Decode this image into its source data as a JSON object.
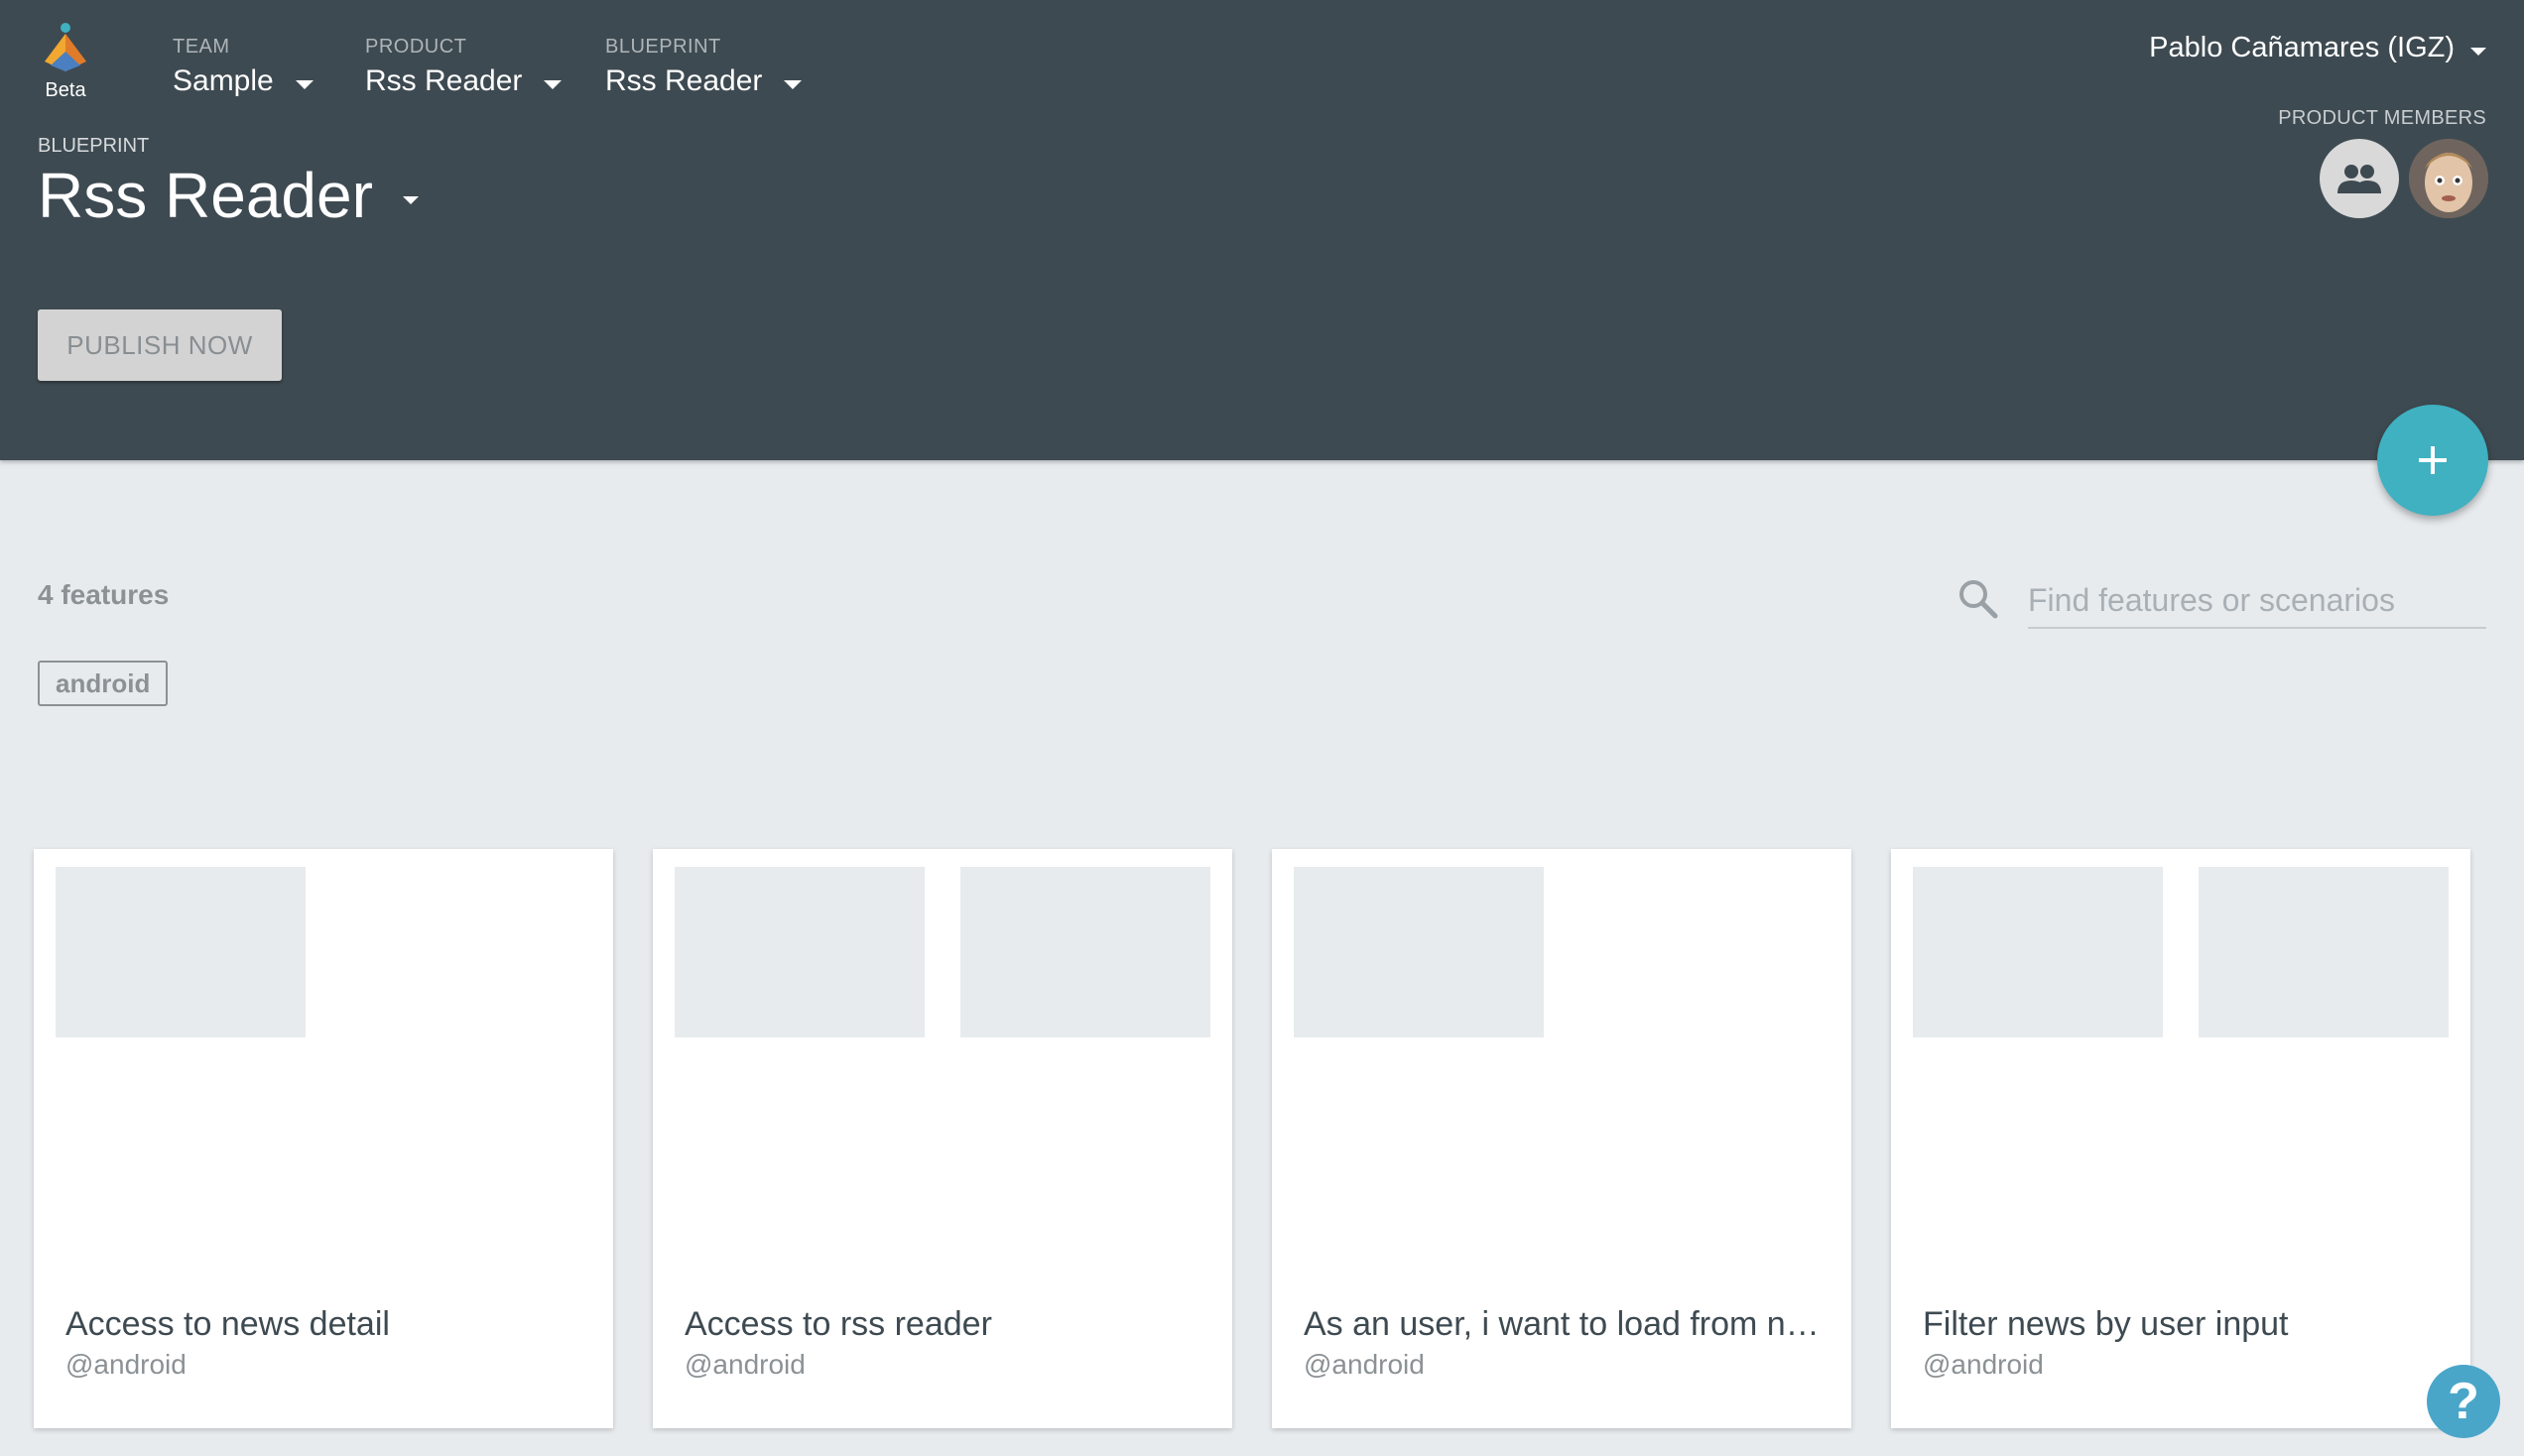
{
  "logo": {
    "label": "Beta"
  },
  "nav": [
    {
      "label": "TEAM",
      "value": "Sample"
    },
    {
      "label": "PRODUCT",
      "value": "Rss Reader"
    },
    {
      "label": "BLUEPRINT",
      "value": "Rss Reader"
    }
  ],
  "blueprint": {
    "label": "BLUEPRINT",
    "title": "Rss Reader"
  },
  "publish_label": "PUBLISH NOW",
  "user": {
    "name": "Pablo Cañamares (IGZ)"
  },
  "members": {
    "label": "PRODUCT MEMBERS",
    "icons": [
      "group-icon",
      "user-avatar"
    ]
  },
  "fab_icon": "plus-icon",
  "features": {
    "count_label": "4 features",
    "search_placeholder": "Find features or scenarios",
    "tag": "android",
    "cards": [
      {
        "title": "Access to news detail",
        "tag": "@android",
        "thumbnails": 1
      },
      {
        "title": "Access to rss reader",
        "tag": "@android",
        "thumbnails": 2
      },
      {
        "title": "As an user, i want to load from network",
        "tag": "@android",
        "thumbnails": 1
      },
      {
        "title": "Filter news by user input",
        "tag": "@android",
        "thumbnails": 2
      }
    ]
  },
  "help_label": "?",
  "colors": {
    "header_bg": "#3e4a51",
    "page_bg": "#e7ebee",
    "accent": "#3fb1c1",
    "help": "#49a6c9"
  }
}
